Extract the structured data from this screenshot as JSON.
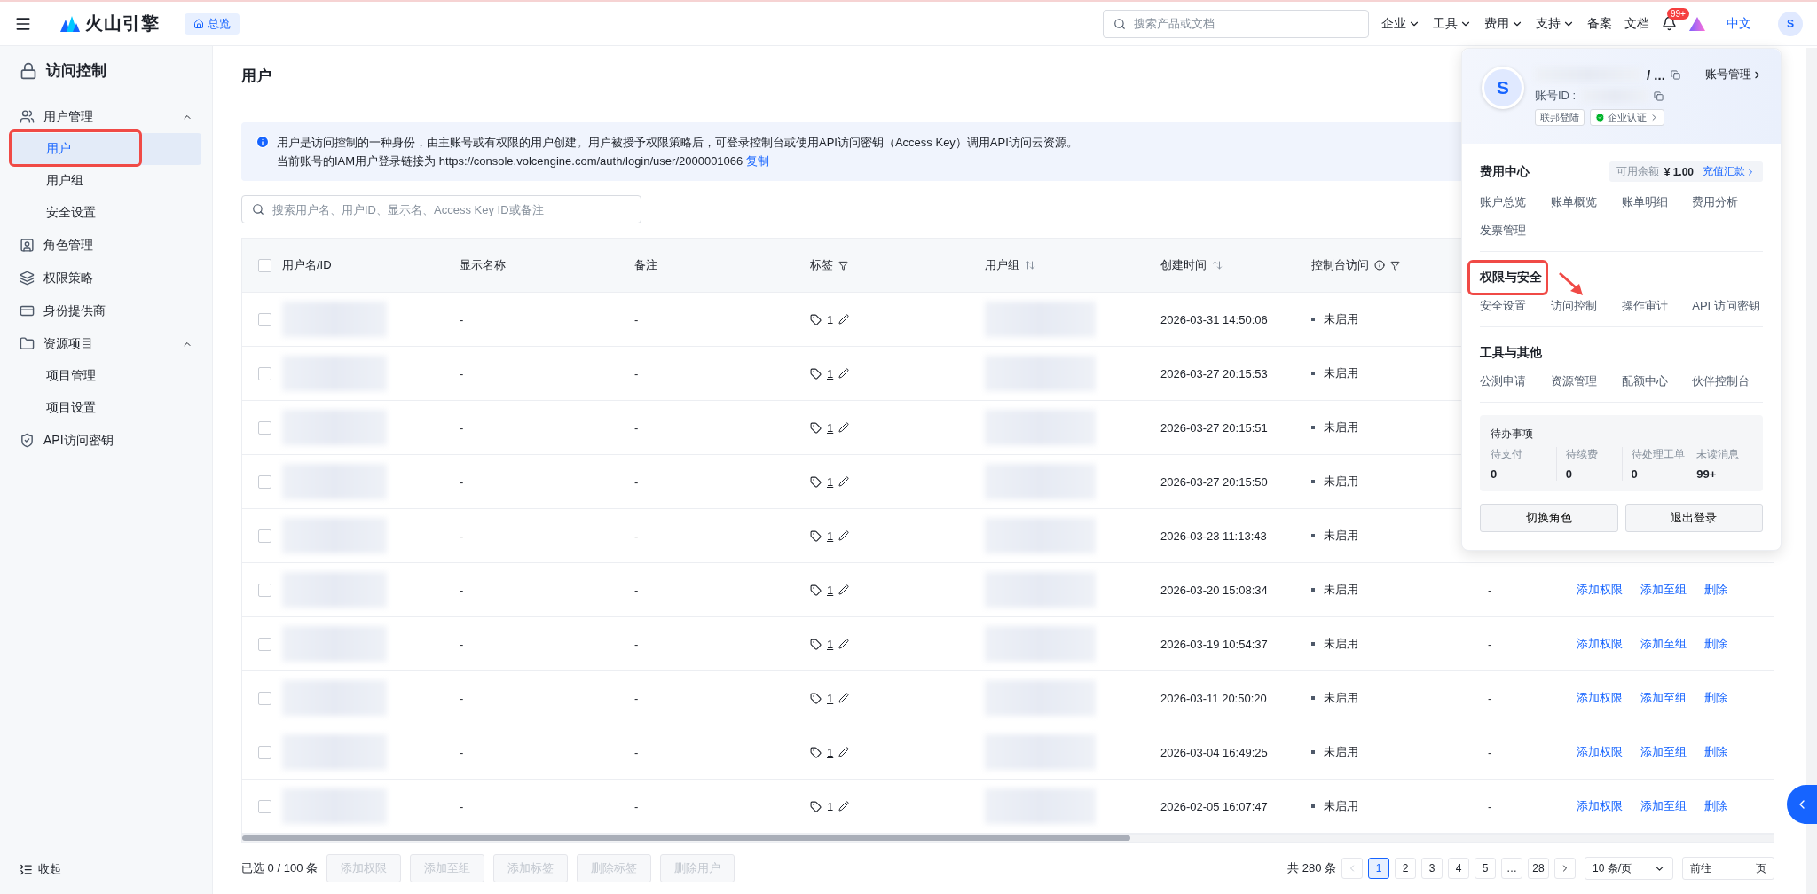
{
  "topbar": {
    "brand": "火山引擎",
    "home_chip": "总览",
    "search": {
      "placeholder": "搜索产品或文档"
    },
    "nav": [
      {
        "label": "企业",
        "dropdown": true
      },
      {
        "label": "工具",
        "dropdown": true
      },
      {
        "label": "费用",
        "dropdown": true
      },
      {
        "label": "支持",
        "dropdown": true
      },
      {
        "label": "备案",
        "dropdown": false
      },
      {
        "label": "文档",
        "dropdown": false
      }
    ],
    "notification_badge": "99+",
    "language": "中文",
    "avatar": "S"
  },
  "sidebar": {
    "title": "访问控制",
    "items": [
      {
        "kind": "group",
        "label": "用户管理",
        "expanded": true,
        "children": [
          {
            "label": "用户",
            "selected": true,
            "highlighted": true
          },
          {
            "label": "用户组",
            "selected": false,
            "highlighted": false
          },
          {
            "label": "安全设置",
            "selected": false,
            "highlighted": false
          }
        ]
      },
      {
        "kind": "item",
        "label": "角色管理"
      },
      {
        "kind": "item",
        "label": "权限策略"
      },
      {
        "kind": "item",
        "label": "身份提供商"
      },
      {
        "kind": "group",
        "label": "资源项目",
        "expanded": true,
        "children": [
          {
            "label": "项目管理",
            "selected": false,
            "highlighted": false
          },
          {
            "label": "项目设置",
            "selected": false,
            "highlighted": false
          }
        ]
      },
      {
        "kind": "item",
        "label": "API访问密钥"
      }
    ],
    "collapse": "收起"
  },
  "page": {
    "title": "用户",
    "notice": {
      "lines": [
        "用户是访问控制的一种身份，由主账号或有权限的用户创建。用户被授予权限策略后，可登录控制台或使用API访问密钥（Access Key）调用API访问云资源。",
        "当前账号的IAM用户登录链接为 https://console.volcengine.com/auth/login/user/2000001066"
      ],
      "link": "复制"
    },
    "search": {
      "placeholder": "搜索用户名、用户ID、显示名、Access Key ID或备注"
    }
  },
  "table": {
    "all_checked": false,
    "columns": [
      {
        "label": "用户名/ID",
        "sort": false,
        "filter": false,
        "info": false
      },
      {
        "label": "显示名称",
        "sort": false,
        "filter": false,
        "info": false
      },
      {
        "label": "备注",
        "sort": false,
        "filter": false,
        "info": false
      },
      {
        "label": "标签",
        "sort": false,
        "filter": true,
        "info": false
      },
      {
        "label": "用户组",
        "sort": true,
        "filter": false,
        "info": false
      },
      {
        "label": "创建时间",
        "sort": true,
        "filter": false,
        "info": false
      },
      {
        "label": "控制台访问",
        "sort": false,
        "filter": true,
        "info": true
      }
    ],
    "rows": [
      {
        "checked": false,
        "display_name": "-",
        "note": "-",
        "tags": "1",
        "created": "2026-03-31 14:50:06",
        "console": "未启用"
      },
      {
        "checked": false,
        "display_name": "-",
        "note": "-",
        "tags": "1",
        "created": "2026-03-27 20:15:53",
        "console": "未启用"
      },
      {
        "checked": false,
        "display_name": "-",
        "note": "-",
        "tags": "1",
        "created": "2026-03-27 20:15:51",
        "console": "未启用"
      },
      {
        "checked": false,
        "display_name": "-",
        "note": "-",
        "tags": "1",
        "created": "2026-03-27 20:15:50",
        "console": "未启用"
      },
      {
        "checked": false,
        "display_name": "-",
        "note": "-",
        "tags": "1",
        "created": "2026-03-23 11:13:43",
        "console": "未启用"
      },
      {
        "checked": false,
        "display_name": "-",
        "note": "-",
        "tags": "1",
        "created": "2026-03-20 15:08:34",
        "console": "未启用",
        "column_8": "-",
        "actions": [
          "添加权限",
          "添加至组",
          "删除"
        ]
      },
      {
        "checked": false,
        "display_name": "-",
        "note": "-",
        "tags": "1",
        "created": "2026-03-19 10:54:37",
        "console": "未启用",
        "column_8": "-",
        "actions": [
          "添加权限",
          "添加至组",
          "删除"
        ]
      },
      {
        "checked": false,
        "display_name": "-",
        "note": "-",
        "tags": "1",
        "created": "2026-03-11 20:50:20",
        "console": "未启用",
        "column_8": "-",
        "actions": [
          "添加权限",
          "添加至组",
          "删除"
        ]
      },
      {
        "checked": false,
        "display_name": "-",
        "note": "-",
        "tags": "1",
        "created": "2026-03-04 16:49:25",
        "console": "未启用",
        "column_8": "-",
        "actions": [
          "添加权限",
          "添加至组",
          "删除"
        ]
      },
      {
        "checked": false,
        "display_name": "-",
        "note": "-",
        "tags": "1",
        "created": "2026-02-05 16:07:47",
        "console": "未启用",
        "column_8": "-",
        "actions": [
          "添加权限",
          "添加至组",
          "删除"
        ]
      }
    ]
  },
  "footer": {
    "selected_count": "已选 0 / 100 条",
    "bulk_actions": [
      {
        "label": "添加权限",
        "disabled": true
      },
      {
        "label": "添加至组",
        "disabled": true
      },
      {
        "label": "添加标签",
        "disabled": true
      },
      {
        "label": "删除标签",
        "disabled": true
      },
      {
        "label": "删除用户",
        "disabled": true
      }
    ],
    "total": "共 280 条",
    "pages": [
      {
        "label": "1",
        "selected": true
      },
      {
        "label": "2",
        "selected": false
      },
      {
        "label": "3",
        "selected": false
      },
      {
        "label": "4",
        "selected": false
      },
      {
        "label": "5",
        "selected": false
      },
      {
        "label": "…",
        "selected": false
      },
      {
        "label": "28",
        "selected": false
      }
    ],
    "page_size": "10 条/页",
    "goto_label": "前往",
    "goto_suffix": "页"
  },
  "account_menu": {
    "avatar": "S",
    "name_suffix": "/ ...",
    "manage": "账号管理",
    "account_id_label": "账号ID :",
    "tags": [
      {
        "label": "联邦登陆",
        "verified": false
      },
      {
        "label": "企业认证",
        "verified": true
      }
    ],
    "billing": {
      "title": "费用中心",
      "balance_label": "可用余额",
      "balance": "¥ 1.00",
      "recharge": "充值汇款",
      "links": [
        "账户总览",
        "账单概览",
        "账单明细",
        "费用分析",
        "发票管理"
      ]
    },
    "sections": [
      {
        "title": "权限与安全",
        "highlighted": true,
        "links": [
          "安全设置",
          "访问控制",
          "操作审计",
          "API 访问密钥"
        ]
      },
      {
        "title": "工具与其他",
        "highlighted": false,
        "links": [
          "公测申请",
          "资源管理",
          "配额中心",
          "伙伴控制台"
        ]
      }
    ],
    "todo": {
      "title": "待办事项",
      "items": [
        {
          "label": "待支付",
          "value": "0"
        },
        {
          "label": "待续费",
          "value": "0"
        },
        {
          "label": "待处理工单",
          "value": "0"
        },
        {
          "label": "未读消息",
          "value": "99+"
        }
      ]
    },
    "buttons": [
      "切换角色",
      "退出登录"
    ]
  }
}
